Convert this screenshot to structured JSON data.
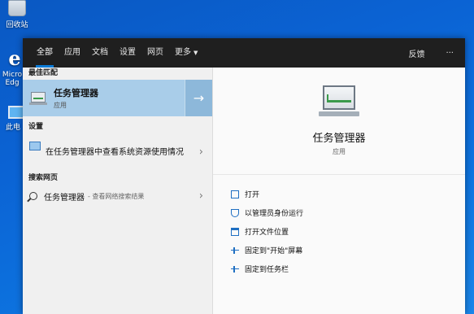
{
  "desktop": {
    "icons": [
      {
        "name": "recycle-bin",
        "label": "回收站"
      },
      {
        "name": "edge",
        "label": "Micro Edg"
      },
      {
        "name": "this-pc",
        "label": "此电"
      }
    ]
  },
  "topbar": {
    "tabs": [
      "全部",
      "应用",
      "文档",
      "设置",
      "网页",
      "更多"
    ],
    "feedback": "反馈",
    "more_options": "···"
  },
  "best_match": {
    "heading": "最佳匹配",
    "name": "任务管理器",
    "type": "应用",
    "arrow": "→"
  },
  "settings": {
    "heading": "设置",
    "item": "在任务管理器中查看系统资源使用情况"
  },
  "web": {
    "heading": "搜索网页",
    "query": "任务管理器",
    "suffix": "- 查看网络搜索结果"
  },
  "detail": {
    "name": "任务管理器",
    "type": "应用",
    "actions": [
      "打开",
      "以管理员身份运行",
      "打开文件位置",
      "固定到\"开始\"屏幕",
      "固定到任务栏"
    ]
  },
  "colors": {
    "accent": "#0a7bd6",
    "selected_bg": "#a9cde9",
    "topbar_bg": "#1f1f1f"
  }
}
